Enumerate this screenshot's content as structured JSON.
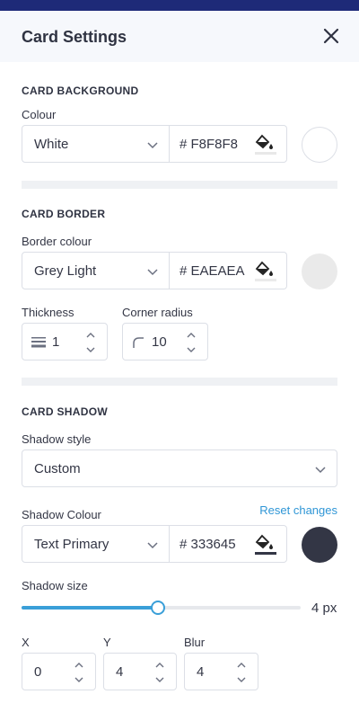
{
  "header": {
    "title": "Card Settings"
  },
  "background": {
    "section_title": "CARD BACKGROUND",
    "colour_label": "Colour",
    "colour_value": "White",
    "hex_value": "# F8F8F8",
    "swatch_color": "#ffffff"
  },
  "border": {
    "section_title": "CARD BORDER",
    "colour_label": "Border colour",
    "colour_value": "Grey Light",
    "hex_value": "# EAEAEA",
    "swatch_color": "#eaeaea",
    "thickness_label": "Thickness",
    "thickness_value": "1",
    "radius_label": "Corner radius",
    "radius_value": "10"
  },
  "shadow": {
    "section_title": "CARD SHADOW",
    "style_label": "Shadow style",
    "style_value": "Custom",
    "reset_label": "Reset changes",
    "colour_label": "Shadow Colour",
    "colour_value": "Text Primary",
    "hex_value": "# 333645",
    "swatch_color": "#333645",
    "size_label": "Shadow size",
    "size_value_text": "4 px",
    "size_fraction": 0.49,
    "x_label": "X",
    "x_value": "0",
    "y_label": "Y",
    "y_value": "4",
    "blur_label": "Blur",
    "blur_value": "4"
  },
  "colors": {
    "accent": "#3a9fd8",
    "topbar": "#1e2a78",
    "header_bg": "#f6f8fc"
  }
}
